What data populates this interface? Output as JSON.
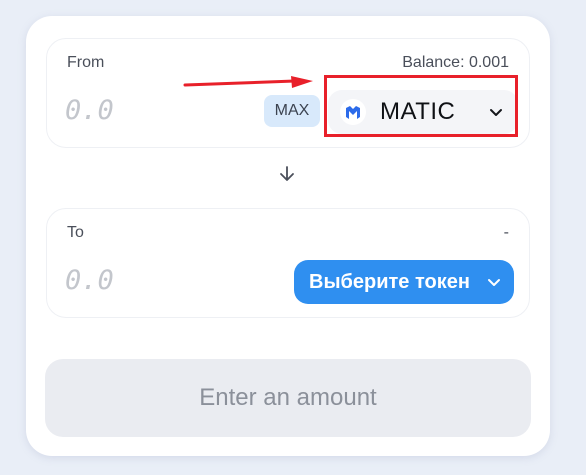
{
  "from": {
    "label": "From",
    "balance_text": "Balance: 0.001",
    "amount_placeholder": "0.0",
    "max_label": "MAX",
    "token": {
      "name": "MATIC",
      "icon": "polygon-logo-icon",
      "icon_color": "#2c6bea"
    }
  },
  "swap_direction_icon": "arrow-down-icon",
  "to": {
    "label": "To",
    "balance_text": "-",
    "amount_placeholder": "0.0",
    "select_token_label": "Выберите токен",
    "select_token_color": "#2f8ff0"
  },
  "action": {
    "label": "Enter an amount"
  },
  "annotation": {
    "highlight_color": "#e8202a",
    "arrow_icon": "red-pointer-arrow-icon"
  }
}
